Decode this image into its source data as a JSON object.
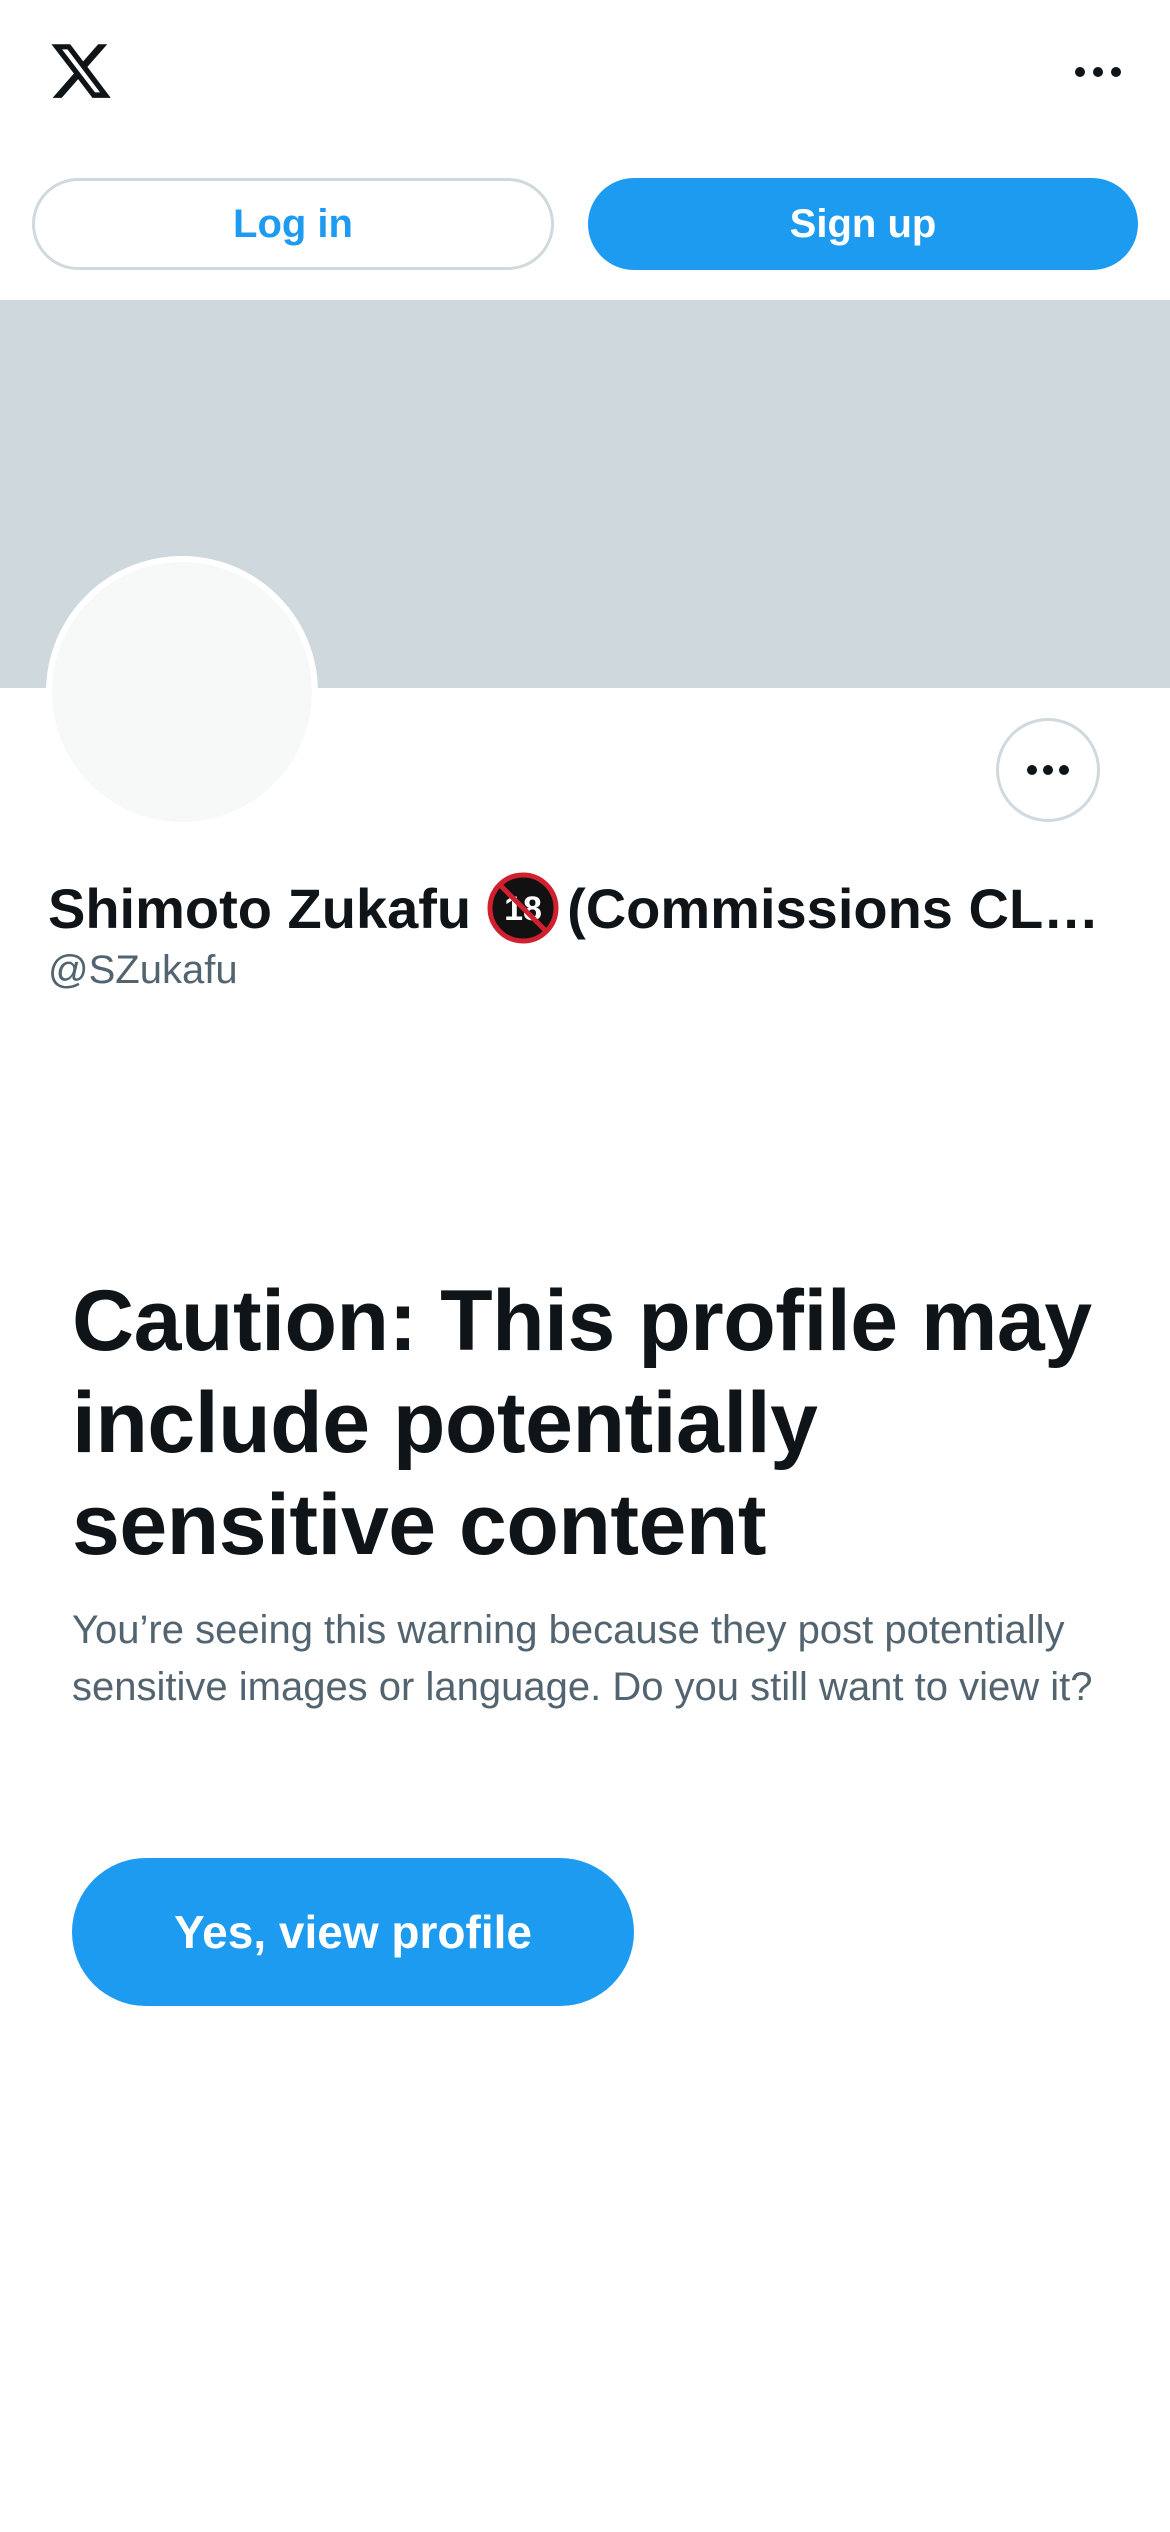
{
  "header": {
    "logo_icon": "x-logo-icon",
    "more_icon": "more-horizontal-icon",
    "login_label": "Log in",
    "signup_label": "Sign up"
  },
  "profile": {
    "name": "Shimoto Zukafu",
    "name_badge_icon": "no-under-18-icon",
    "name_rest": "(Commissions CL…",
    "handle": "@SZukafu",
    "more_icon": "more-horizontal-icon"
  },
  "warning": {
    "title": "Caution: This profile may include potentially sensitive content",
    "body": "You’re seeing this warning because they post potentially sensitive images or language. Do you still want to view it?",
    "confirm_label": "Yes, view profile"
  },
  "colors": {
    "accent": "#1d9bf0",
    "banner": "#cfd9dd",
    "text_primary": "#0f1419",
    "text_secondary": "#536471",
    "border": "#cfd9de"
  }
}
